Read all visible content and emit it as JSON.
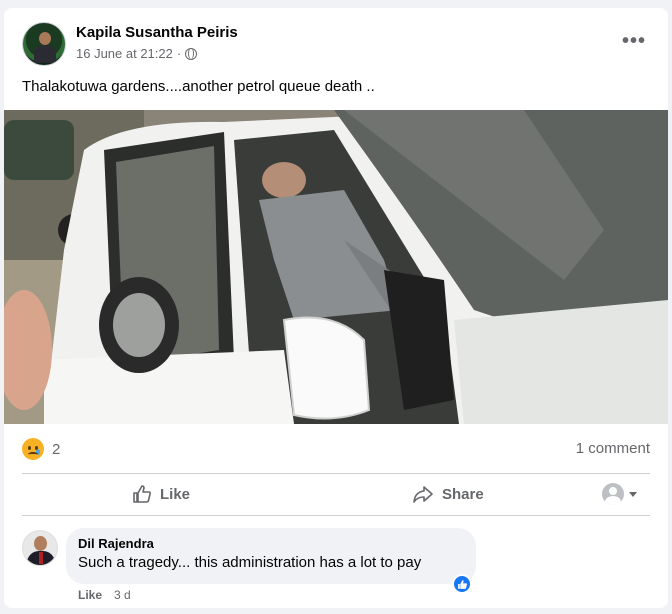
{
  "post": {
    "author": "Kapila Susantha Peiris",
    "timestamp": "16 June at 21:22",
    "privacy_icon": "globe-icon",
    "more_icon": "more-options-icon",
    "more_label": "•••",
    "text": "Thalakotuwa gardens....another petrol queue death .."
  },
  "stats": {
    "reaction_icon": "sad-reaction-icon",
    "reaction_count": "2",
    "comment_count": "1 comment"
  },
  "actions": {
    "like_label": "Like",
    "share_label": "Share"
  },
  "comment": {
    "author": "Dil Rajendra",
    "text": "Such a tragedy... this administration has a lot to pay",
    "like_label": "Like",
    "time": "3 d"
  },
  "colors": {
    "accent": "#1877f2",
    "secondary_text": "#65676b",
    "background": "#f0f2f5"
  }
}
